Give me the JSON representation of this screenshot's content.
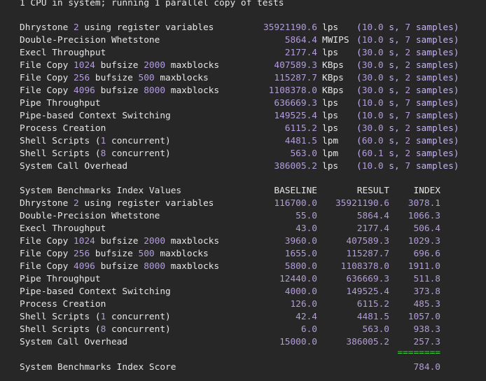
{
  "header_line": "1 CPU in system; running 1 parallel copy of tests",
  "results": [
    {
      "pre": "Dhrystone ",
      "n1": "2",
      "mid": " using register variables",
      "n2": "",
      "post": "",
      "value": "35921190.6",
      "unit": "lps",
      "time": "10.0",
      "samples": "7"
    },
    {
      "pre": "Double-Precision Whetstone",
      "n1": "",
      "mid": "",
      "n2": "",
      "post": "",
      "value": "5864.4",
      "unit": "MWIPS",
      "time": "10.0",
      "samples": "7"
    },
    {
      "pre": "Execl Throughput",
      "n1": "",
      "mid": "",
      "n2": "",
      "post": "",
      "value": "2177.4",
      "unit": "lps",
      "time": "30.0",
      "samples": "2"
    },
    {
      "pre": "File Copy ",
      "n1": "1024",
      "mid": " bufsize ",
      "n2": "2000",
      "post": " maxblocks",
      "value": "407589.3",
      "unit": "KBps",
      "time": "30.0",
      "samples": "2"
    },
    {
      "pre": "File Copy ",
      "n1": "256",
      "mid": " bufsize ",
      "n2": "500",
      "post": " maxblocks",
      "value": "115287.7",
      "unit": "KBps",
      "time": "30.0",
      "samples": "2"
    },
    {
      "pre": "File Copy ",
      "n1": "4096",
      "mid": " bufsize ",
      "n2": "8000",
      "post": " maxblocks",
      "value": "1108378.0",
      "unit": "KBps",
      "time": "30.0",
      "samples": "2"
    },
    {
      "pre": "Pipe Throughput",
      "n1": "",
      "mid": "",
      "n2": "",
      "post": "",
      "value": "636669.3",
      "unit": "lps",
      "time": "10.0",
      "samples": "7"
    },
    {
      "pre": "Pipe-based Context Switching",
      "n1": "",
      "mid": "",
      "n2": "",
      "post": "",
      "value": "149525.4",
      "unit": "lps",
      "time": "10.0",
      "samples": "7"
    },
    {
      "pre": "Process Creation",
      "n1": "",
      "mid": "",
      "n2": "",
      "post": "",
      "value": "6115.2",
      "unit": "lps",
      "time": "30.0",
      "samples": "2"
    },
    {
      "pre": "Shell Scripts (",
      "n1": "1",
      "mid": " concurrent)",
      "n2": "",
      "post": "",
      "value": "4481.5",
      "unit": "lpm",
      "time": "60.0",
      "samples": "2"
    },
    {
      "pre": "Shell Scripts (",
      "n1": "8",
      "mid": " concurrent)",
      "n2": "",
      "post": "",
      "value": "563.0",
      "unit": "lpm",
      "time": "60.1",
      "samples": "2"
    },
    {
      "pre": "System Call Overhead",
      "n1": "",
      "mid": "",
      "n2": "",
      "post": "",
      "value": "386005.2",
      "unit": "lps",
      "time": "10.0",
      "samples": "7"
    }
  ],
  "sample_word": "s,",
  "samples_word": "samples)",
  "index_header": {
    "title": "System Benchmarks Index Values",
    "baseline": "BASELINE",
    "result": "RESULT",
    "index": "INDEX"
  },
  "index_rows": [
    {
      "pre": "Dhrystone ",
      "n1": "2",
      "mid": " using register variables",
      "n2": "",
      "post": "",
      "baseline": "116700.0",
      "result": "35921190.6",
      "index": "3078.1"
    },
    {
      "pre": "Double-Precision Whetstone",
      "n1": "",
      "mid": "",
      "n2": "",
      "post": "",
      "baseline": "55.0",
      "result": "5864.4",
      "index": "1066.3"
    },
    {
      "pre": "Execl Throughput",
      "n1": "",
      "mid": "",
      "n2": "",
      "post": "",
      "baseline": "43.0",
      "result": "2177.4",
      "index": "506.4"
    },
    {
      "pre": "File Copy ",
      "n1": "1024",
      "mid": " bufsize ",
      "n2": "2000",
      "post": " maxblocks",
      "baseline": "3960.0",
      "result": "407589.3",
      "index": "1029.3"
    },
    {
      "pre": "File Copy ",
      "n1": "256",
      "mid": " bufsize ",
      "n2": "500",
      "post": " maxblocks",
      "baseline": "1655.0",
      "result": "115287.7",
      "index": "696.6"
    },
    {
      "pre": "File Copy ",
      "n1": "4096",
      "mid": " bufsize ",
      "n2": "8000",
      "post": " maxblocks",
      "baseline": "5800.0",
      "result": "1108378.0",
      "index": "1911.0"
    },
    {
      "pre": "Pipe Throughput",
      "n1": "",
      "mid": "",
      "n2": "",
      "post": "",
      "baseline": "12440.0",
      "result": "636669.3",
      "index": "511.8"
    },
    {
      "pre": "Pipe-based Context Switching",
      "n1": "",
      "mid": "",
      "n2": "",
      "post": "",
      "baseline": "4000.0",
      "result": "149525.4",
      "index": "373.8"
    },
    {
      "pre": "Process Creation",
      "n1": "",
      "mid": "",
      "n2": "",
      "post": "",
      "baseline": "126.0",
      "result": "6115.2",
      "index": "485.3"
    },
    {
      "pre": "Shell Scripts (",
      "n1": "1",
      "mid": " concurrent)",
      "n2": "",
      "post": "",
      "baseline": "42.4",
      "result": "4481.5",
      "index": "1057.0"
    },
    {
      "pre": "Shell Scripts (",
      "n1": "8",
      "mid": " concurrent)",
      "n2": "",
      "post": "",
      "baseline": "6.0",
      "result": "563.0",
      "index": "938.3"
    },
    {
      "pre": "System Call Overhead",
      "n1": "",
      "mid": "",
      "n2": "",
      "post": "",
      "baseline": "15000.0",
      "result": "386005.2",
      "index": "257.3"
    }
  ],
  "separator": "========",
  "score_label": "System Benchmarks Index Score",
  "score_value": "784.0",
  "colors": {
    "background": "#272727",
    "text": "#e6e6e6",
    "number": "#b39ddb",
    "separator": "#3ecf3e"
  }
}
